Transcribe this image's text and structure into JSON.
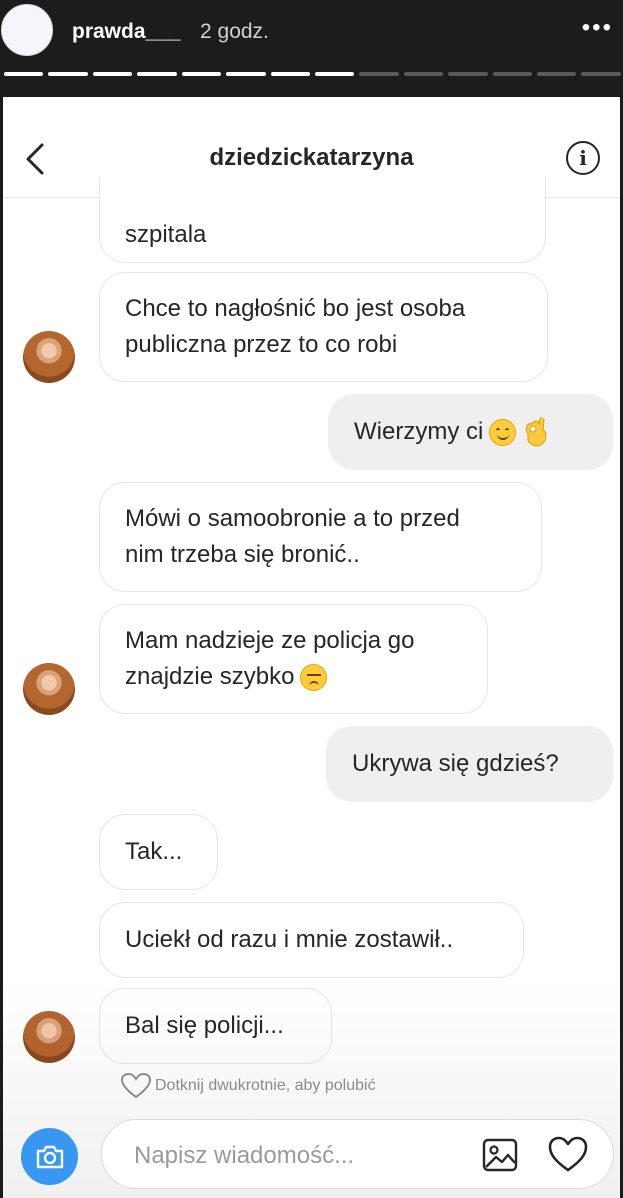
{
  "story": {
    "username": "prawda___",
    "time": "2 godz.",
    "more": "•••",
    "progress": {
      "total": 14,
      "completed": 8
    }
  },
  "dm": {
    "title": "dziedzickatarzyna",
    "info_label": "i"
  },
  "messages": [
    {
      "sender": "them",
      "text": "szpitala"
    },
    {
      "sender": "them",
      "text_lines": [
        "Chce to nagłośnić bo jest osoba",
        "publiczna przez to co robi"
      ]
    },
    {
      "sender": "me",
      "text": "Wierzymy ci",
      "emojis": [
        "smiling-face-emoji",
        "ok-hand-emoji"
      ]
    },
    {
      "sender": "them",
      "text_lines": [
        "Mówi o samoobronie a to przed",
        "nim trzeba się bronić.."
      ]
    },
    {
      "sender": "them",
      "text_lines": [
        "Mam nadzieje ze policja go",
        "znajdzie szybko"
      ],
      "emojis": [
        "disappointed-face-emoji"
      ]
    },
    {
      "sender": "me",
      "text": "Ukrywa się gdzieś?"
    },
    {
      "sender": "them",
      "text": "Tak..."
    },
    {
      "sender": "them",
      "text": "Uciekł od razu i mnie zostawił.."
    },
    {
      "sender": "them",
      "text": "Bal się policji..."
    }
  ],
  "like_hint": "Dotknij dwukrotnie, aby polubić",
  "composer": {
    "placeholder": "Napisz wiadomość..."
  },
  "colors": {
    "accent": "#3897f0",
    "story_bar": "#1c1c1c",
    "my_bubble": "#efefef"
  }
}
